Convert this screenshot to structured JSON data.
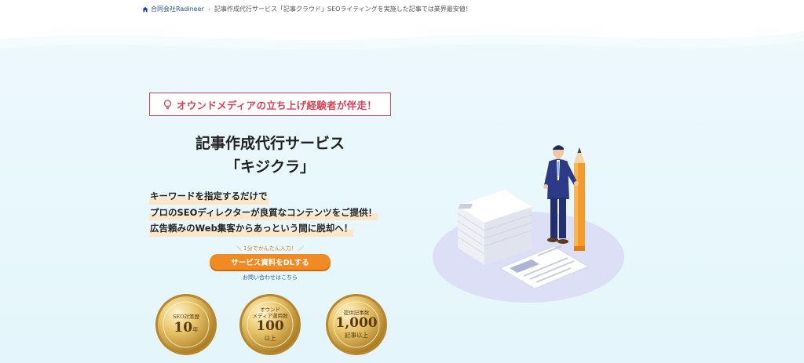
{
  "breadcrumb": {
    "home": "合同会社Radineer",
    "separator": "›",
    "current": "記事作成代行サービス「記事クラウド」SEOライティングを実施した記事では業界最安値！"
  },
  "hero": {
    "catch": "オウンドメディアの立ち上げ経験者が伴走！",
    "title_line1": "記事作成代行サービス",
    "title_line2": "「キジクラ」",
    "lead": [
      "キーワードを指定するだけで",
      "プロのSEOディレクターが良質なコンテンツをご提供！",
      "広告頼みのWeb集客からあっという間に脱却へ！"
    ],
    "cta_note": "＼ 1分でかんたん入力！ ／",
    "cta_label": "サービス資料をDLする",
    "contact_link": "お問い合わせはこちら"
  },
  "medals": [
    {
      "top": "SEO対策歴",
      "number": "10",
      "unit": "年"
    },
    {
      "top": "オウンド",
      "top2": "メディア運用数",
      "number": "100",
      "unit": "以上"
    },
    {
      "top": "提供記事数",
      "number": "1,000",
      "unit": "記事以上"
    }
  ],
  "colors": {
    "accent_red": "#d94154",
    "cta_orange": "#f08a24",
    "background": "#e7f7fb",
    "link_blue": "#2c5fa3"
  },
  "icons": {
    "home": "home-icon",
    "catch": "lightbulb-icon"
  }
}
